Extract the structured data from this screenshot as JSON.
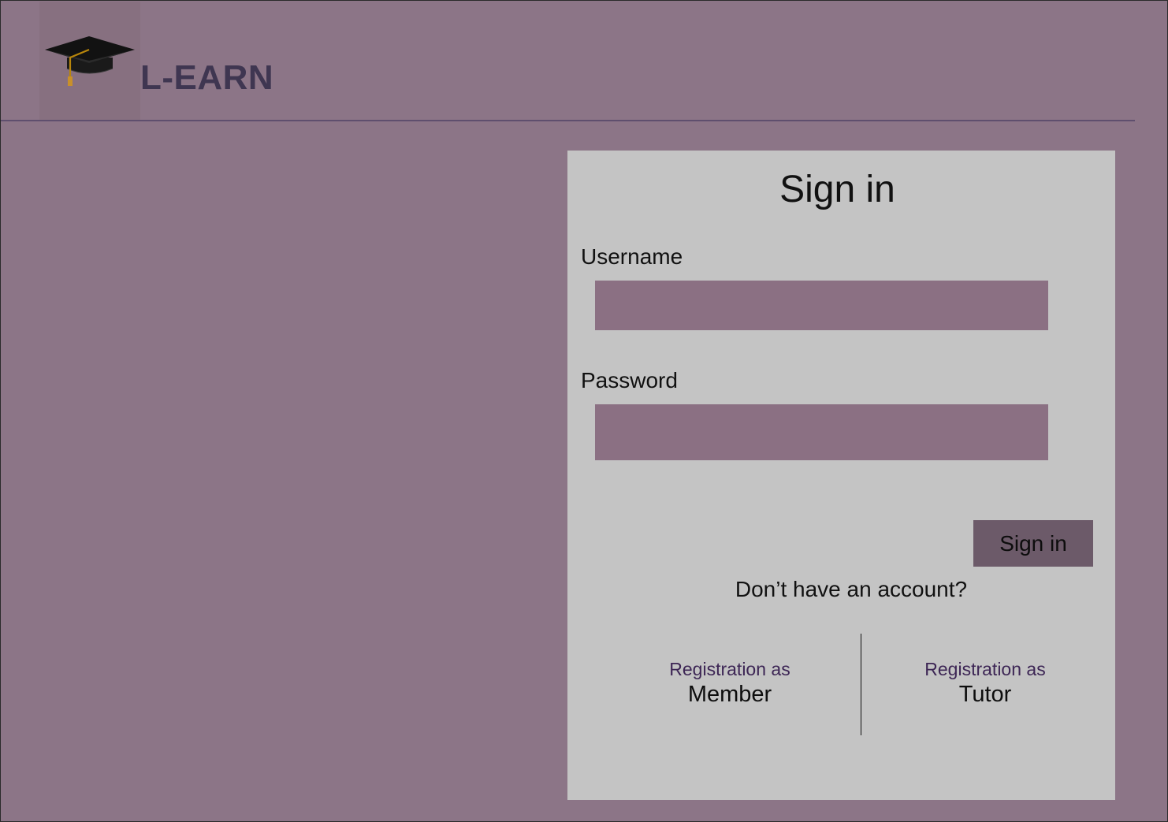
{
  "header": {
    "brand": "L-EARN",
    "logo_icon": "graduation-cap-icon"
  },
  "signin_card": {
    "title": "Sign in",
    "username_label": "Username",
    "username_value": "",
    "password_label": "Password",
    "password_value": "",
    "submit_label": "Sign in",
    "no_account_text": "Don’t have an account?",
    "registration_options": [
      {
        "prefix": "Registration as",
        "role": "Member"
      },
      {
        "prefix": "Registration as",
        "role": "Tutor"
      }
    ]
  },
  "colors": {
    "background": "#8c7587",
    "card": "#c4c4c4",
    "input": "#8b7083",
    "button": "#6c5a69",
    "brand_text": "#3f3651",
    "registration_prefix": "#3d2655"
  }
}
